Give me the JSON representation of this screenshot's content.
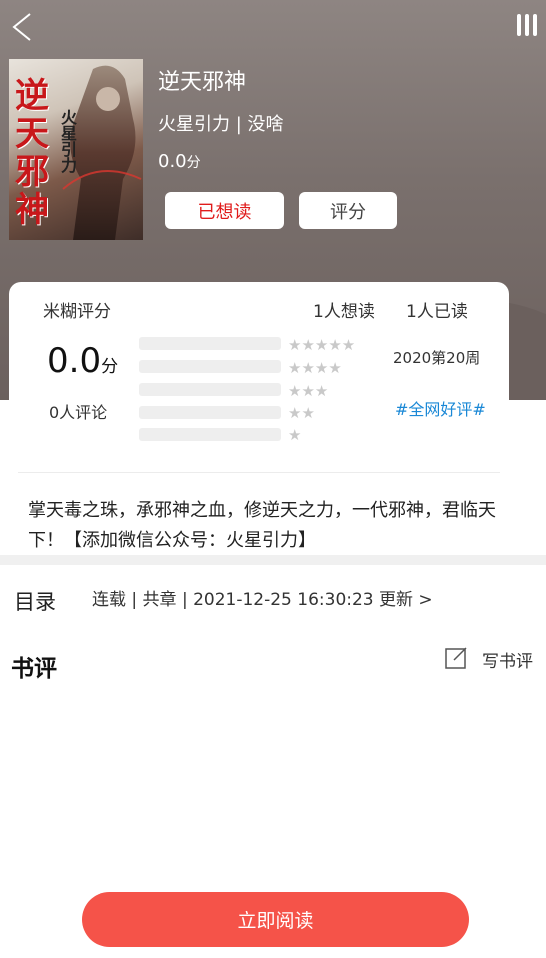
{
  "header": {
    "back_icon": "chevron-left-icon",
    "menu_icon": "menu-bars-icon"
  },
  "book": {
    "cover_title": "逆天邪神",
    "cover_author": "火星引力",
    "title": "逆天邪神",
    "author_line": "火星引力 | 没啥",
    "score": "0.0",
    "score_unit": "分",
    "want_button": "已想读",
    "rate_button": "评分"
  },
  "rating": {
    "label": "米糊评分",
    "want_count": "1人想读",
    "read_count": "1人已读",
    "score": "0.0",
    "score_unit": "分",
    "review_count": "0人评论",
    "star_rows": [
      {
        "stars": "★★★★★",
        "fraction": 0
      },
      {
        "stars": "★★★★",
        "fraction": 0
      },
      {
        "stars": "★★★",
        "fraction": 0
      },
      {
        "stars": "★★",
        "fraction": 0
      },
      {
        "stars": "★",
        "fraction": 0
      }
    ],
    "week": "2020第20周",
    "tag": "#全网好评#"
  },
  "summary": "掌天毒之珠，承邪神之血，修逆天之力，一代邪神，君临天下！【添加微信公众号：火星引力】",
  "toc": {
    "label": "目录",
    "info": "连载 | 共章 | 2021-12-25 16:30:23 更新 >"
  },
  "reviews": {
    "heading": "书评",
    "write_label": "写书评",
    "write_icon": "edit-icon"
  },
  "read_button": "立即阅读",
  "colors": {
    "accent": "#f55349",
    "want_text": "#e01c1c",
    "tag": "#1a88d6",
    "header_bg": "#8e8582"
  }
}
